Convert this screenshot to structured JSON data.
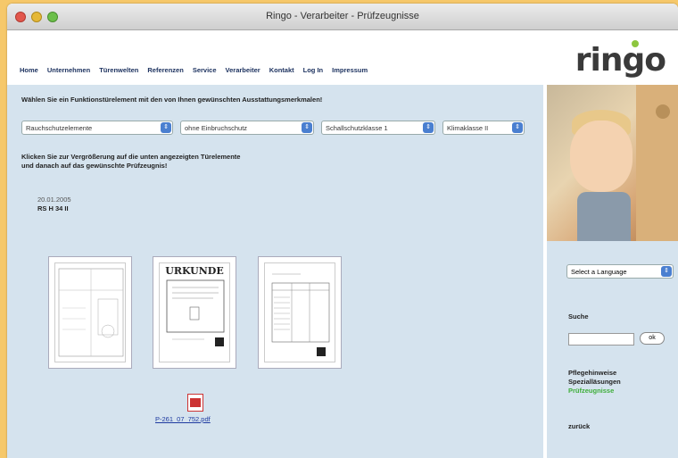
{
  "window": {
    "title": "Ringo - Verarbeiter - Prüfzeugnisse"
  },
  "header": {
    "logo": "ringo",
    "nav": [
      "Home",
      "Unternehmen",
      "Türenwelten",
      "Referenzen",
      "Service",
      "Verarbeiter",
      "Kontakt",
      "Log In",
      "Impressum"
    ]
  },
  "main": {
    "instruction": "Wählen Sie ein Funktionstürelement mit den von Ihnen gewünschten Ausstattungsmerkmalen!",
    "selects": [
      "Rauchschutzelemente",
      "ohne Einbruchschutz",
      "Schallschutzklasse 1",
      "Klimaklasse II"
    ],
    "click_text_line1": "Klicken Sie zur Vergrößerung auf die unten angezeigten Türelemente",
    "click_text_line2": "und danach auf das gewünschte Prüfzeugnis!",
    "date": "20.01.2005",
    "code": "RS H 34 II",
    "urkunde": "URKUNDE",
    "pdf_link": "P-261_07_752.pdf"
  },
  "sidebar": {
    "language_select": "Select a Language",
    "search_label": "Suche",
    "search_value": "",
    "ok_label": "ok",
    "links": [
      "Pflegehinweise",
      "Spezialläsungen",
      "Prüfzeugnisse"
    ],
    "back_label": "zurück"
  },
  "colors": {
    "page_bg": "#f6c86a",
    "content_bg": "#d5e3ee",
    "nav_color": "#1e3360",
    "active_link": "#3fae3a"
  }
}
